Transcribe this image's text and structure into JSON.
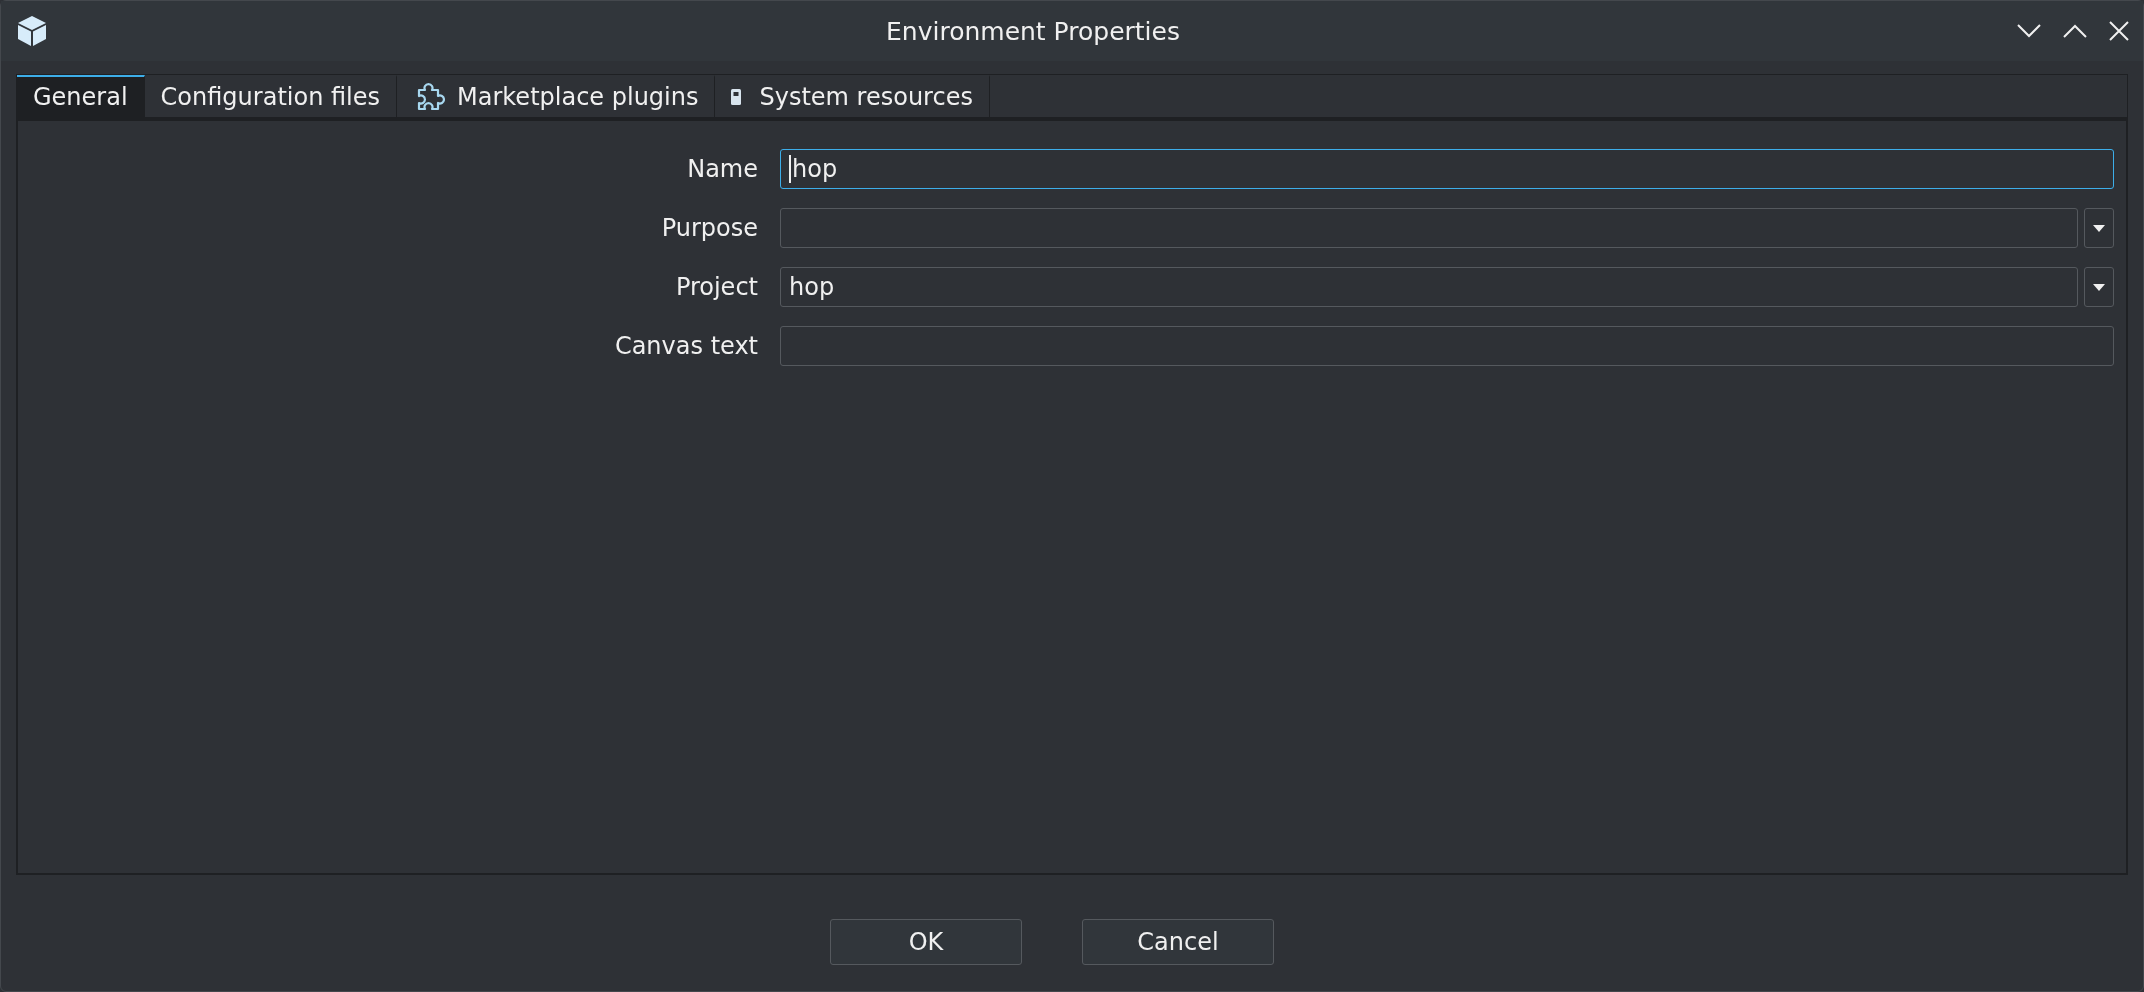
{
  "window": {
    "title": "Environment Properties"
  },
  "tabs": [
    {
      "label": "General",
      "selected": true
    },
    {
      "label": "Configuration files",
      "selected": false
    },
    {
      "label": "Marketplace plugins",
      "selected": false
    },
    {
      "label": "System resources",
      "selected": false
    }
  ],
  "form": [
    {
      "label": "Name",
      "kind": "text",
      "value": "hop",
      "focused": true
    },
    {
      "label": "Purpose",
      "kind": "combo",
      "focused": false
    },
    {
      "label": "Project",
      "kind": "combo",
      "value": "hop",
      "focused": false
    },
    {
      "label": "Canvas text",
      "kind": "text",
      "focused": false
    }
  ],
  "buttons": [
    "OK",
    "Cancel"
  ]
}
